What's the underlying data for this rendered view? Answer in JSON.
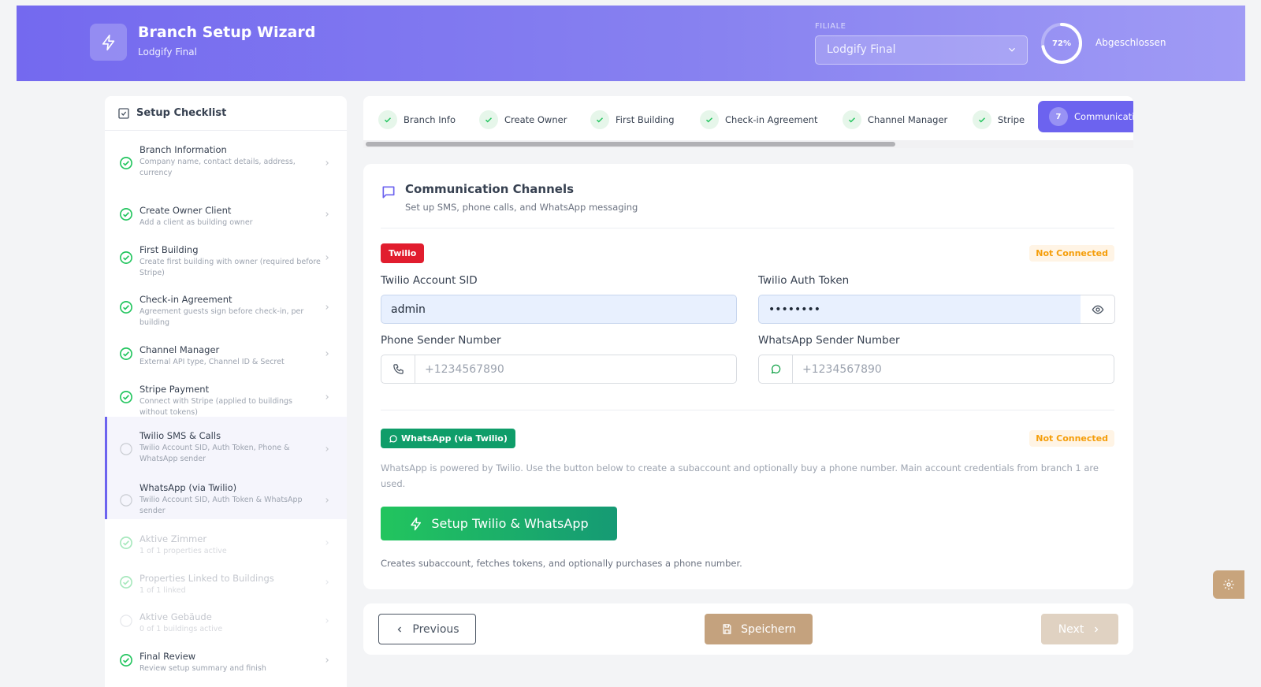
{
  "header": {
    "title": "Branch Setup Wizard",
    "subtitle": "Lodgify Final",
    "filiale_label": "FILIALE",
    "filiale_value": "Lodgify Final",
    "progress_percent": 72,
    "progress_text": "72%",
    "progress_status": "Abgeschlossen"
  },
  "sidebar": {
    "title": "Setup Checklist",
    "items": [
      {
        "title": "Branch Information",
        "desc": "Company name, contact details, address, currency",
        "status": "done"
      },
      {
        "title": "Create Owner Client",
        "desc": "Add a client as building owner",
        "status": "done"
      },
      {
        "title": "First Building",
        "desc": "Create first building with owner (required before Stripe)",
        "status": "done"
      },
      {
        "title": "Check-in Agreement",
        "desc": "Agreement guests sign before check-in, per building",
        "status": "done"
      },
      {
        "title": "Channel Manager",
        "desc": "External API type, Channel ID & Secret",
        "status": "done"
      },
      {
        "title": "Stripe Payment",
        "desc": "Connect with Stripe (applied to buildings without tokens)",
        "status": "done"
      },
      {
        "title": "Twilio SMS & Calls",
        "desc": "Twilio Account SID, Auth Token, Phone & WhatsApp sender",
        "status": "active"
      },
      {
        "title": "WhatsApp (via Twilio)",
        "desc": "Twilio Account SID, Auth Token & WhatsApp sender",
        "status": "active"
      },
      {
        "title": "Aktive Zimmer",
        "desc": "1 of 1 properties active",
        "status": "done-faded"
      },
      {
        "title": "Properties Linked to Buildings",
        "desc": "1 of 1 linked",
        "status": "done-faded"
      },
      {
        "title": "Aktive Gebäude",
        "desc": "0 of 1 buildings active",
        "status": "pending-faded"
      },
      {
        "title": "Final Review",
        "desc": "Review setup summary and finish",
        "status": "done"
      }
    ]
  },
  "steps": [
    {
      "label": "Branch Info",
      "status": "done"
    },
    {
      "label": "Create Owner",
      "status": "done"
    },
    {
      "label": "First Building",
      "status": "done"
    },
    {
      "label": "Check-in Agreement",
      "status": "done"
    },
    {
      "label": "Channel Manager",
      "status": "done"
    },
    {
      "label": "Stripe",
      "status": "done"
    },
    {
      "label": "Communicati",
      "number": "7",
      "status": "current"
    }
  ],
  "section": {
    "title": "Communication Channels",
    "subtitle": "Set up SMS, phone calls, and WhatsApp messaging"
  },
  "twilio": {
    "badge": "Twilio",
    "status": "Not Connected",
    "sid_label": "Twilio Account SID",
    "sid_value": "admin",
    "token_label": "Twilio Auth Token",
    "token_value": "••••••••",
    "phone_label": "Phone Sender Number",
    "phone_placeholder": "+1234567890",
    "wa_label": "WhatsApp Sender Number",
    "wa_placeholder": "+1234567890"
  },
  "whatsapp": {
    "badge": "WhatsApp (via Twilio)",
    "status": "Not Connected",
    "note": "WhatsApp is powered by Twilio. Use the button below to create a subaccount and optionally buy a phone number. Main account credentials from branch 1 are used.",
    "button": "Setup Twilio & WhatsApp",
    "button_note": "Creates subaccount, fetches tokens, and optionally purchases a phone number."
  },
  "footer": {
    "previous": "Previous",
    "save": "Speichern",
    "next": "Next"
  },
  "colors": {
    "accent": "#6c63ef",
    "success": "#22c55e",
    "danger": "#e11d2e",
    "warning": "#f59e0b",
    "save": "#c4a27e"
  }
}
